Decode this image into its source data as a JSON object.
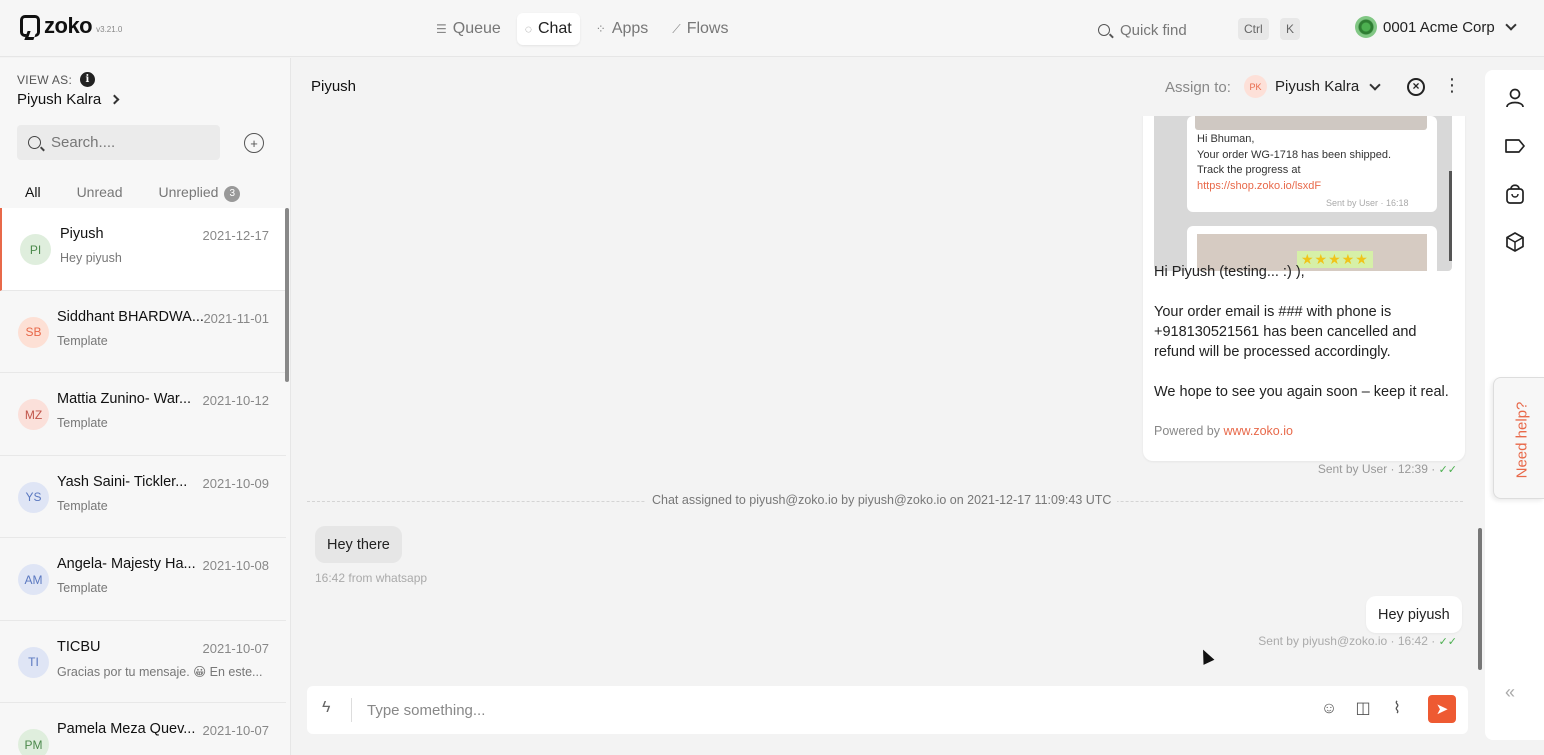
{
  "app": {
    "name": "zoko",
    "version": "v3.21.0",
    "nav": [
      {
        "label": "Queue",
        "icon": "queue-icon"
      },
      {
        "label": "Chat",
        "icon": "chat-icon",
        "active": true
      },
      {
        "label": "Apps",
        "icon": "apps-icon"
      },
      {
        "label": "Flows",
        "icon": "flows-icon"
      }
    ],
    "quickfind": {
      "label": "Quick find",
      "keys": [
        "Ctrl",
        "K"
      ]
    },
    "org": "0001 Acme Corp"
  },
  "sidebar": {
    "view_as_label": "VIEW AS:",
    "view_as_user": "Piyush Kalra",
    "search_placeholder": "Search....",
    "tabs": [
      {
        "label": "All",
        "active": true
      },
      {
        "label": "Unread"
      },
      {
        "label": "Unreplied",
        "badge": "3"
      }
    ],
    "conversations": [
      {
        "initials": "PI",
        "name": "Piyush",
        "date": "2021-12-17",
        "preview": "Hey piyush",
        "avatar_bg": "#dfeedd",
        "avatar_fg": "#4c8a4c",
        "selected": true
      },
      {
        "initials": "SB",
        "name": "Siddhant BHARDWA...",
        "date": "2021-11-01",
        "preview": "Template",
        "avatar_bg": "#fde0d5",
        "avatar_fg": "#e8694a"
      },
      {
        "initials": "MZ",
        "name": "Mattia Zunino- War...",
        "date": "2021-10-12",
        "preview": "Template",
        "avatar_bg": "#fbe0da",
        "avatar_fg": "#c0544a"
      },
      {
        "initials": "YS",
        "name": "Yash Saini- Tickler...",
        "date": "2021-10-09",
        "preview": "Template",
        "avatar_bg": "#dfe5f5",
        "avatar_fg": "#5a78c0"
      },
      {
        "initials": "AM",
        "name": "Angela- Majesty Ha...",
        "date": "2021-10-08",
        "preview": "Template",
        "avatar_bg": "#dfe5f5",
        "avatar_fg": "#5a78c0"
      },
      {
        "initials": "TI",
        "name": "TICBU",
        "date": "2021-10-07",
        "preview": "Gracias por tu mensaje. 😀 En este...",
        "avatar_bg": "#dfe5f5",
        "avatar_fg": "#5a78c0"
      },
      {
        "initials": "PM",
        "name": "Pamela Meza Quev...",
        "date": "2021-10-07",
        "preview": "",
        "avatar_bg": "#dfeedd",
        "avatar_fg": "#4c8a4c"
      }
    ]
  },
  "chat": {
    "title": "Piyush",
    "assign_label": "Assign to:",
    "assignee_initials": "PK",
    "assignee": "Piyush Kalra",
    "preview": {
      "greeting": "Hi Bhuman,",
      "line1": "Your order WG-1718 has been shipped.",
      "line2": "Track the progress at",
      "link": "https://shop.zoko.io/lsxdF",
      "meta": "Sent by User · 16:18"
    },
    "outgoing_message": {
      "p1": "Hi Piyush (testing... :) ),",
      "p2": "Your order email is ### with phone is +918130521561 has been cancelled and refund will be processed accordingly.",
      "p3": "We hope to see you again soon – keep it real.",
      "powered_prefix": "Powered by ",
      "powered_link": "www.zoko.io",
      "meta": "Sent by User · 12:39 ·"
    },
    "system_message": "Chat assigned to piyush@zoko.io by piyush@zoko.io on 2021-12-17 11:09:43 UTC",
    "incoming": {
      "text": "Hey there",
      "meta": "16:42 from whatsapp"
    },
    "reply": {
      "text": "Hey piyush",
      "meta": "Sent by piyush@zoko.io · 16:42 ·"
    },
    "composer_placeholder": "Type something..."
  },
  "help": {
    "label": "Need help?"
  },
  "colors": {
    "accent": "#e8694a",
    "send": "#ee5a32"
  }
}
